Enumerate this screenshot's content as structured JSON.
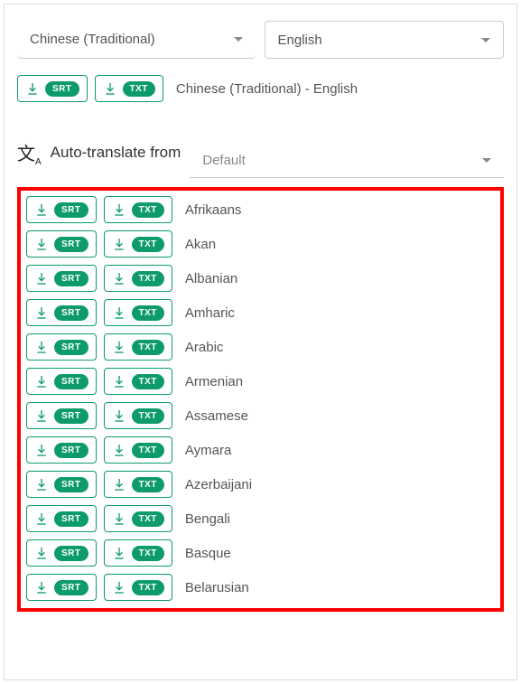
{
  "source_lang": "Chinese (Traditional)",
  "target_lang": "English",
  "pair_label": "Chinese (Traditional) - English",
  "srt_label": "SRT",
  "txt_label": "TXT",
  "auto_translate_label": "Auto-translate from",
  "default_label": "Default",
  "languages": [
    "Afrikaans",
    "Akan",
    "Albanian",
    "Amharic",
    "Arabic",
    "Armenian",
    "Assamese",
    "Aymara",
    "Azerbaijani",
    "Bengali",
    "Basque",
    "Belarusian"
  ]
}
